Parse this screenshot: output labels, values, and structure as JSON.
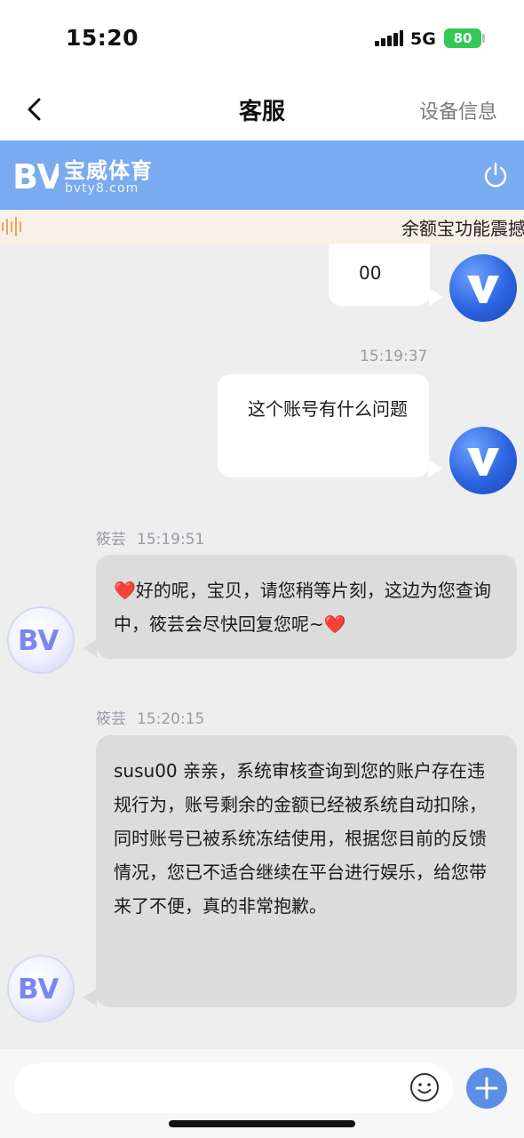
{
  "status_bar": {
    "time": "15:20",
    "network": "5G",
    "battery": "80"
  },
  "nav": {
    "title": "客服",
    "right_label": "设备信息"
  },
  "banner": {
    "brand_name": "宝威体育",
    "brand_domain": "bvty8.com",
    "logo_text": "BV"
  },
  "marquee": {
    "text": "余额宝功能震撼"
  },
  "messages": [
    {
      "side": "right",
      "text": "00"
    },
    {
      "side": "right",
      "time": "15:19:37",
      "text": "这个账号有什么问题"
    },
    {
      "side": "left",
      "sender": "筱芸",
      "time": "15:19:51",
      "heart": "❤️",
      "text": "好的呢，宝贝，请您稍等片刻，这边为您查询中，筱芸会尽快回复您呢~",
      "heart_end": "❤️",
      "avatar_text": "BV"
    },
    {
      "side": "left",
      "sender": "筱芸",
      "time": "15:20:15",
      "text": "susu00  亲亲，系统审核查询到您的账户存在违规行为，账号剩余的金额已经被系统自动扣除，同时账号已被系统冻结使用，根据您目前的反馈情况，您已不适合继续在平台进行娱乐，给您带来了不便，真的非常抱歉。",
      "avatar_text": "BV"
    }
  ],
  "input": {
    "placeholder": "",
    "value": ""
  },
  "icons": {
    "back": "chevron-left-icon",
    "power": "power-icon",
    "sound": "sound-wave-icon",
    "emoji": "smiley-icon",
    "add": "plus-icon"
  },
  "colors": {
    "banner": "#7aaaf0",
    "chat_background": "#eeeeee",
    "agent_bubble": "#dcdcdc",
    "user_bubble": "#ffffff",
    "add_button": "#5b8ee6",
    "battery": "#34c759"
  }
}
